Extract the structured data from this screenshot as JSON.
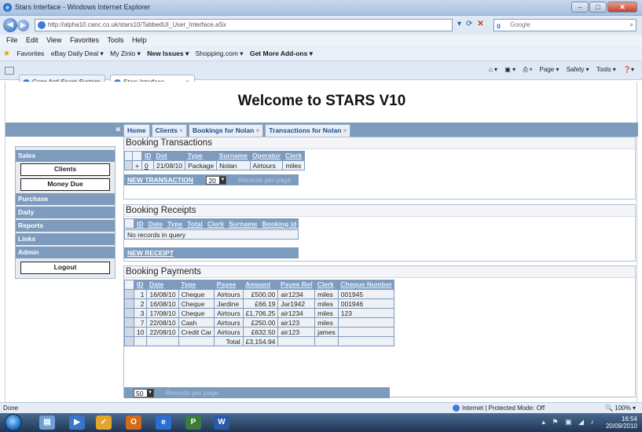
{
  "window": {
    "title": "Stars Interface - Windows Internet Explorer"
  },
  "address_bar": {
    "url": "http://alpha10.canc.co.uk/stars10/TabbedUI_User_Interface.aSx",
    "search_placeholder": "Google"
  },
  "menu": [
    "File",
    "Edit",
    "View",
    "Favorites",
    "Tools",
    "Help"
  ],
  "favorites_bar": {
    "favorites_label": "Favorites",
    "items": [
      "eBay Daily Deal ▾",
      "My Zinio ▾",
      "New Issues ▾",
      "Shopping.com ▾",
      "Get More Add-ons ▾"
    ]
  },
  "browser_tabs": [
    "Canc Anti Spam System",
    "Stars Interface"
  ],
  "command_bar": [
    "Page ▾",
    "Safety ▾",
    "Tools ▾"
  ],
  "page": {
    "title": "Welcome to STARS V10",
    "collapse_glyph": "«",
    "tabs": [
      {
        "label": "Home",
        "closable": false
      },
      {
        "label": "Clients",
        "closable": true
      },
      {
        "label": "Bookings for Nolan",
        "closable": true
      },
      {
        "label": "Transactions for Nolan",
        "closable": true
      }
    ],
    "tab_close_glyph": "×",
    "sidebar": {
      "sales": "Sales",
      "clients": "Clients",
      "money_due": "Money Due",
      "purchase": "Purchase",
      "daily": "Daily",
      "reports": "Reports",
      "links": "Links",
      "admin": "Admin",
      "logout": "Logout"
    },
    "transactions": {
      "title": "Booking Transactions",
      "headers": [
        "ID",
        "Dot",
        "Type",
        "Surname",
        "Operator",
        "Clerk"
      ],
      "rows": [
        {
          "id": "0",
          "dot": "21/08/10",
          "type": "Package",
          "surname": "Nolan",
          "operator": "Airtours",
          "clerk": "miles"
        }
      ],
      "new_link": "NEW TRANSACTION",
      "page_size": "20",
      "records_label": "Records per page"
    },
    "receipts": {
      "title": "Booking Receipts",
      "headers": [
        "ID",
        "Date",
        "Type",
        "Total",
        "Clerk",
        "Surname",
        "Booking id"
      ],
      "empty": "No records in query",
      "new_link": "NEW RECEIPT"
    },
    "payments": {
      "title": "Booking Payments",
      "headers": [
        "ID",
        "Date",
        "Type",
        "Payee",
        "Amount",
        "Payee Ref",
        "Clerk",
        "Cheque Number"
      ],
      "rows": [
        {
          "id": "1",
          "date": "16/08/10",
          "type": "Cheque",
          "payee": "Airtours",
          "amount": "£500.00",
          "ref": "air1234",
          "clerk": "miles",
          "cheque": "001945"
        },
        {
          "id": "2",
          "date": "16/08/10",
          "type": "Cheque",
          "payee": "Jardine",
          "amount": "£66.19",
          "ref": "Jar1942",
          "clerk": "miles",
          "cheque": "001946"
        },
        {
          "id": "3",
          "date": "17/08/10",
          "type": "Cheque",
          "payee": "Airtours",
          "amount": "£1,706.25",
          "ref": "air1234",
          "clerk": "miles",
          "cheque": "123"
        },
        {
          "id": "7",
          "date": "22/08/10",
          "type": "Cash",
          "payee": "Airtours",
          "amount": "£250.00",
          "ref": "air123",
          "clerk": "miles",
          "cheque": ""
        },
        {
          "id": "10",
          "date": "22/08/10",
          "type": "Credit Car",
          "payee": "Airtours",
          "amount": "£632.50",
          "ref": "air123",
          "clerk": "james",
          "cheque": ""
        }
      ],
      "total_label": "Total",
      "total_value": "£3,154.94",
      "page_size": "50",
      "records_label": "Records per page"
    }
  },
  "status": {
    "left": "Done",
    "zone": "Internet | Protected Mode: Off",
    "zoom": "100%"
  },
  "taskbar": {
    "time": "16:54",
    "date": "20/09/2010"
  }
}
